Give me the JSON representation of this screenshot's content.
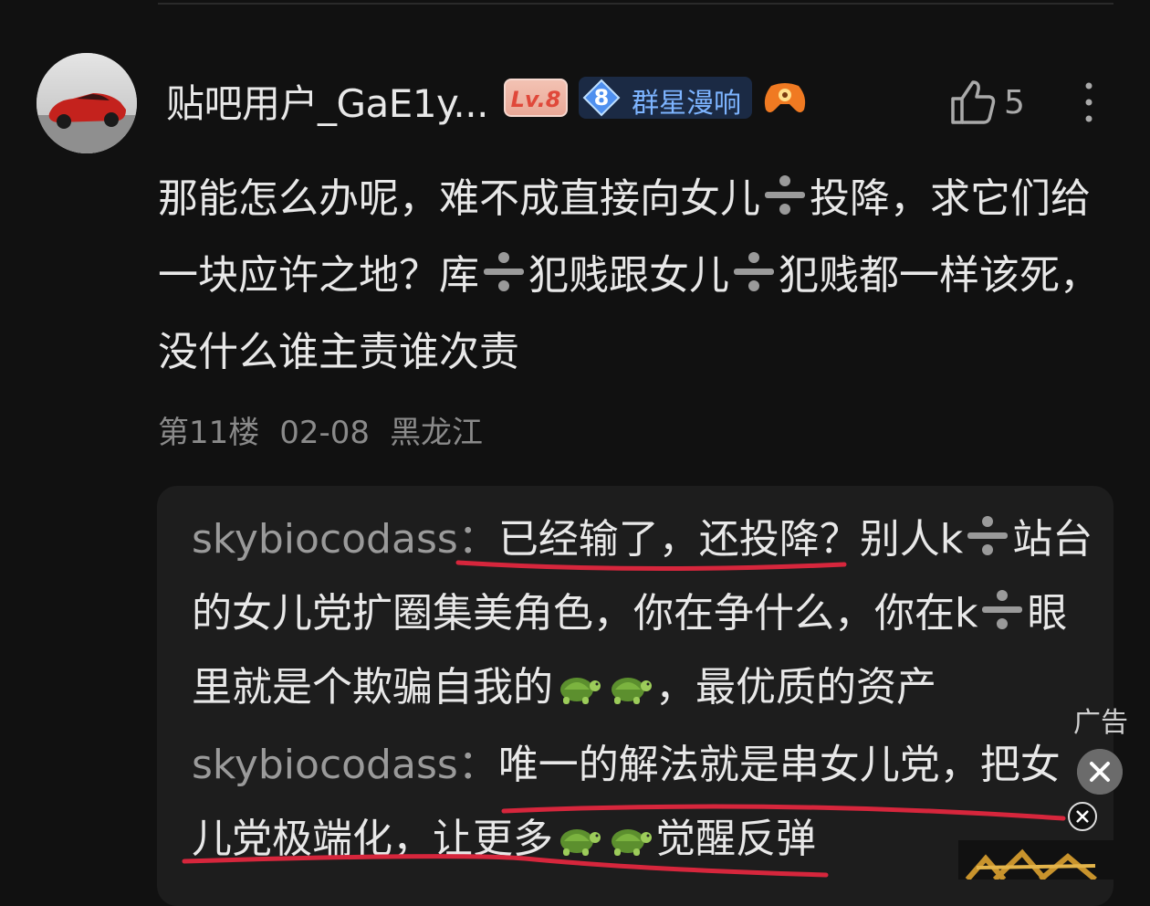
{
  "post": {
    "username": "贴吧用户_GaE1y...",
    "level_badge": "Lv.8",
    "fan_badge": {
      "level": "8",
      "name": "群星漫响"
    },
    "likes": "5",
    "content_parts": [
      "那能怎么办呢，难不成直接向女儿",
      "投降，求它们给一块应许之地？库",
      "犯贱跟女儿",
      "犯贱都一样该死，没什么谁主责谁次责"
    ],
    "floor": "第11楼",
    "date": "02-08",
    "location": "黑龙江"
  },
  "replies": [
    {
      "user": "skybiocodass：",
      "parts": [
        "已经输了，还投降？别人k",
        "站台的女儿党扩圈集美角色，你在争什么，你在k",
        "眼里就是个欺骗自我的",
        "，最优质的资产"
      ]
    },
    {
      "user": "skybiocodass：",
      "parts": [
        "唯一的解法就是串女儿党，把女儿党极端化，让更多",
        "觉醒反弹"
      ]
    }
  ],
  "ad": {
    "label": "广告"
  },
  "icons": {
    "like": "thumbs-up-icon",
    "more": "more-vertical-icon",
    "gamepad": "gamepad-icon",
    "close": "close-icon",
    "divide": "divide-emoji",
    "turtle": "turtle-emoji"
  },
  "colors": {
    "background": "#111111",
    "reply_bg": "#1d1d1d",
    "annotation": "#d6263c",
    "fan_name": "#7db4ff",
    "level_badge": "#e0483a"
  }
}
